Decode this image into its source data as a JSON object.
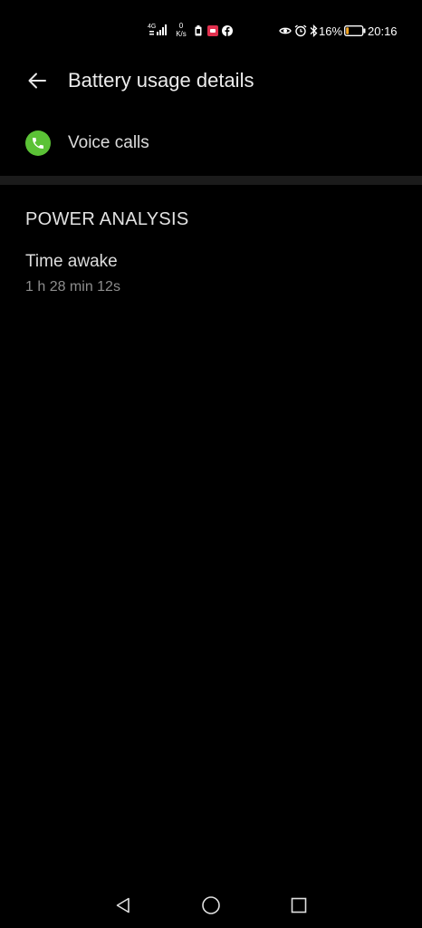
{
  "status_bar": {
    "network_type": "4G",
    "network_speed_value": "0",
    "network_speed_unit": "K/s",
    "battery_percent": "16%",
    "time": "20:16",
    "icons": [
      "signal-icon",
      "sim-icon",
      "notification-app-icon",
      "facebook-icon",
      "eye-icon",
      "alarm-icon",
      "bluetooth-icon",
      "battery-icon"
    ],
    "battery_level": 0.16,
    "battery_color": "#f5a623"
  },
  "header": {
    "title": "Battery usage details",
    "back_icon": "arrow-left-icon"
  },
  "app": {
    "name": "Voice calls",
    "icon": "phone-icon",
    "icon_color": "#5bc236"
  },
  "power_analysis": {
    "section_title": "POWER ANALYSIS",
    "items": [
      {
        "title": "Time awake",
        "value": "1 h 28 min 12s"
      }
    ]
  },
  "nav_bar": {
    "buttons": [
      "back-triangle-icon",
      "home-circle-icon",
      "recents-square-icon"
    ]
  }
}
